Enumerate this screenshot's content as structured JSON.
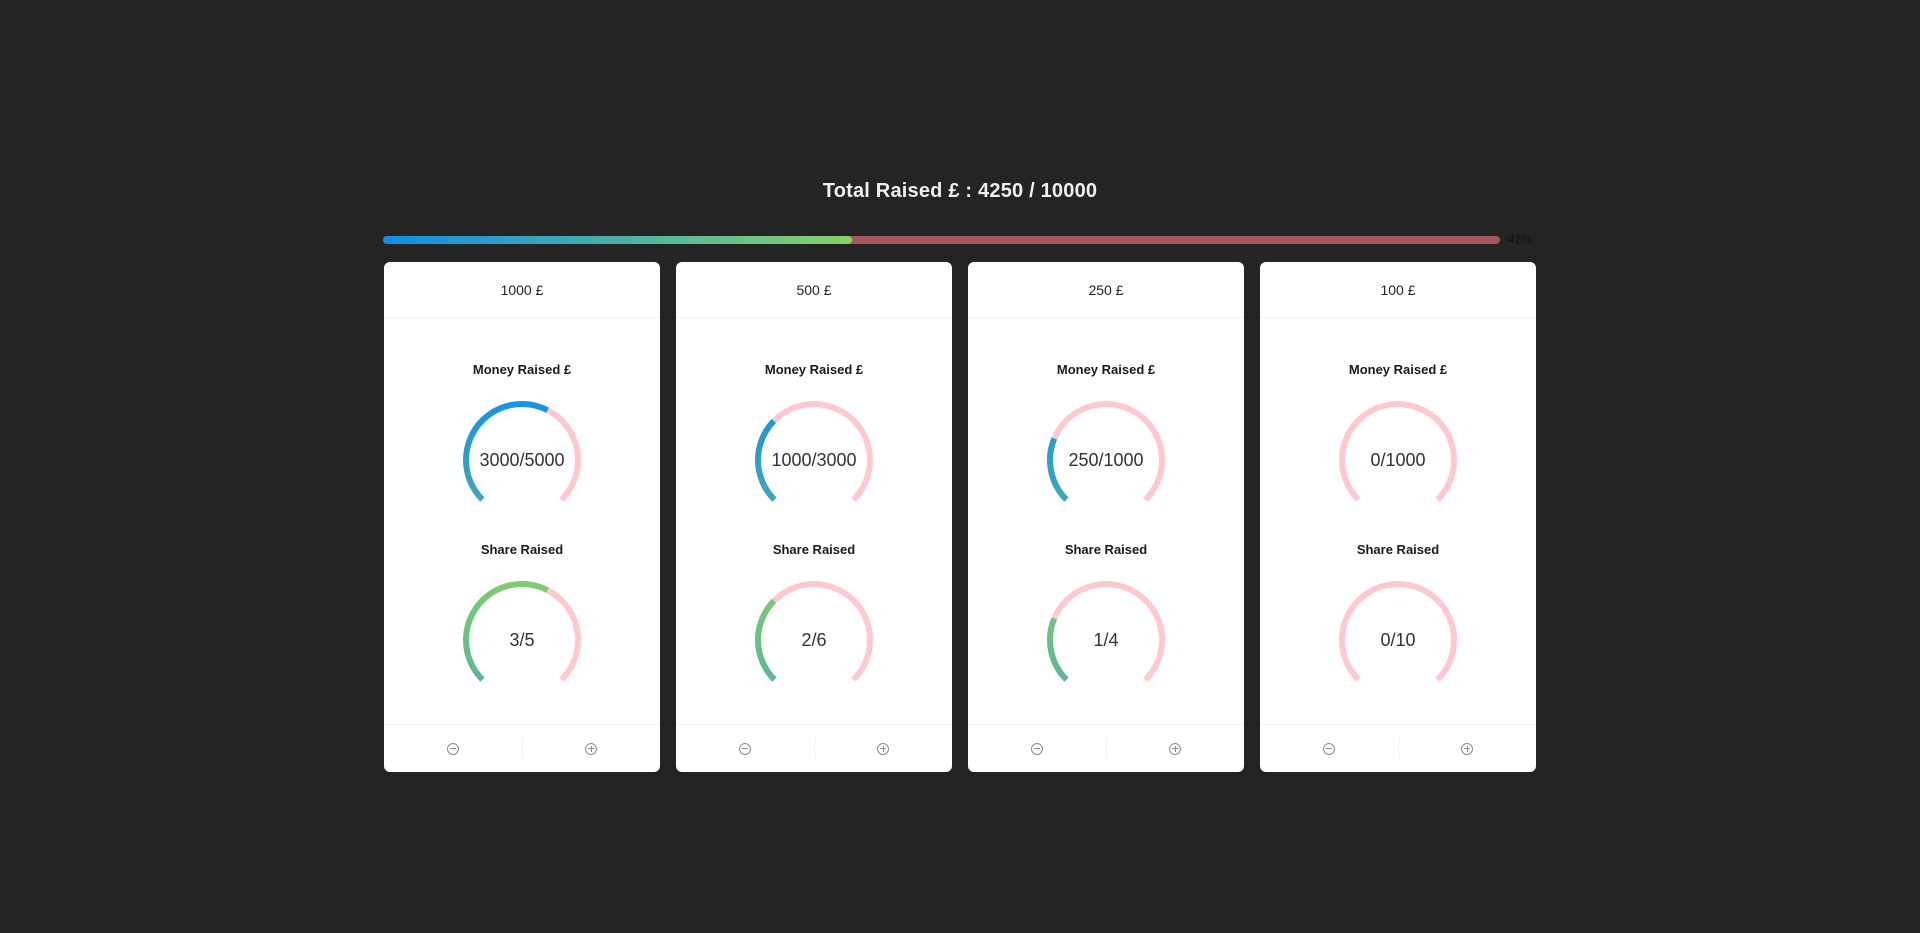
{
  "header": {
    "title": "Total Raised £ : 4250 / 10000"
  },
  "progress": {
    "percent": 42,
    "label": "42%",
    "colors": {
      "start": "#108ee9",
      "end": "#87d068",
      "track": "#a3585f"
    }
  },
  "gauge_colors": {
    "track": "#ffc8cf",
    "money_start": "#108ee9",
    "money_end": "#4eafa6",
    "share_start": "#87d068",
    "share_end": "#4eafa6"
  },
  "cards": [
    {
      "title": "1000 £",
      "money_label": "Money Raised £",
      "money_text": "3000/5000",
      "money_percent": 60,
      "share_label": "Share Raised",
      "share_text": "3/5",
      "share_percent": 60,
      "minus_icon": "minus-circle-icon",
      "plus_icon": "plus-circle-icon"
    },
    {
      "title": "500 £",
      "money_label": "Money Raised £",
      "money_text": "1000/3000",
      "money_percent": 33,
      "share_label": "Share Raised",
      "share_text": "2/6",
      "share_percent": 33,
      "minus_icon": "minus-circle-icon",
      "plus_icon": "plus-circle-icon"
    },
    {
      "title": "250 £",
      "money_label": "Money Raised £",
      "money_text": "250/1000",
      "money_percent": 25,
      "share_label": "Share Raised",
      "share_text": "1/4",
      "share_percent": 25,
      "minus_icon": "minus-circle-icon",
      "plus_icon": "plus-circle-icon"
    },
    {
      "title": "100 £",
      "money_label": "Money Raised £",
      "money_text": "0/1000",
      "money_percent": 0,
      "share_label": "Share Raised",
      "share_text": "0/10",
      "share_percent": 0,
      "minus_icon": "minus-circle-icon",
      "plus_icon": "plus-circle-icon"
    }
  ]
}
